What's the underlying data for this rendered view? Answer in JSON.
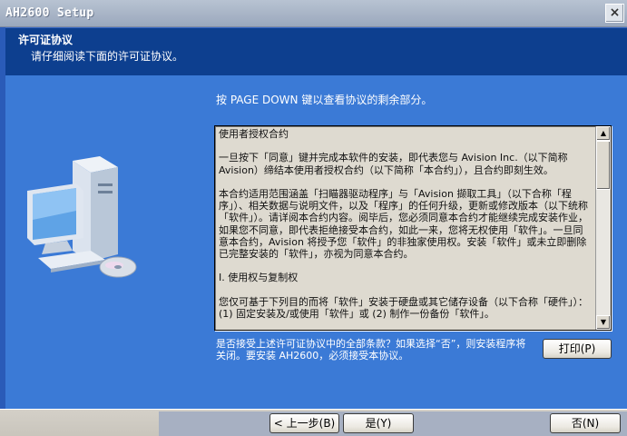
{
  "window": {
    "title": "AH2600 Setup",
    "close_glyph": "×"
  },
  "header": {
    "title": "许可证协议",
    "subtitle": "请仔细阅读下面的许可证协议。"
  },
  "hint": "按 PAGE DOWN 键以查看协议的剩余部分。",
  "license": {
    "paragraphs": [
      "使用者授权合约",
      "一旦按下「同意」键并完成本软件的安装，即代表您与 Avision Inc.（以下简称 Avision）缔结本使用者授权合约（以下简称「本合约」），且合约即刻生效。",
      "本合约适用范围涵盖「扫瞄器驱动程序」与「Avision 撷取工具」（以下合称「程序」）、相关数据与说明文件，以及「程序」的任何升级，更新或修改版本（以下统称「软件」）。请详阅本合约内容。阅毕后，您必须同意本合约才能继续完成安装作业，如果您不同意，即代表拒绝接受本合约，如此一来，您将无权使用「软件」。一旦同意本合约，Avision 将授予您「软件」的非独家使用权。安装「软件」或未立即删除已完整安装的「软件」，亦视为同意本合约。",
      "I. 使用权与复制权",
      "您仅可基于下列目的而将「软件」安装于硬盘或其它储存设备（以下合称「硬件」）：(1) 固定安装及/或使用「软件」或 (2) 制作一份备份「软件」。"
    ]
  },
  "question": "是否接受上述许可证协议中的全部条款？如果选择“否”，则安装程序将关闭。要安装 AH2600，必须接受本协议。",
  "buttons": {
    "print": "打印(P)",
    "back": "< 上一步(B)",
    "yes": "是(Y)",
    "no": "否(N)"
  },
  "scrollbar": {
    "up_glyph": "▲",
    "down_glyph": "▼"
  }
}
